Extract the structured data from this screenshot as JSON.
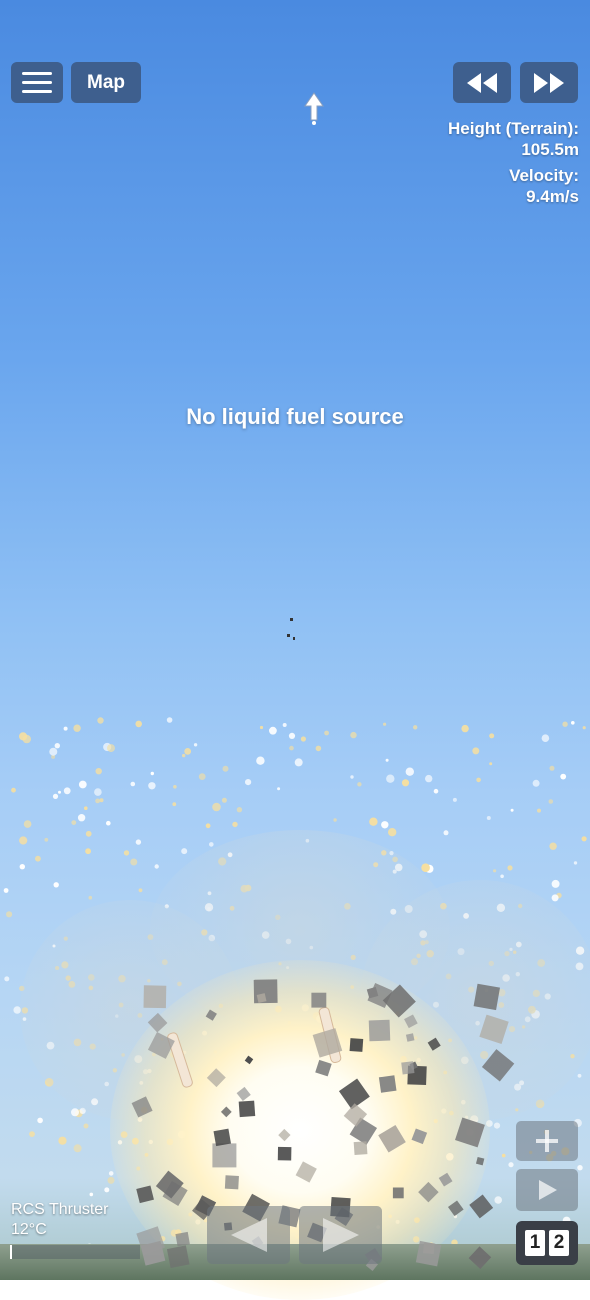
{
  "top_bar": {
    "menu_icon": "hamburger-menu-icon",
    "map_label": "Map",
    "rewind_icon": "rewind-icon",
    "fast_forward_icon": "fast-forward-icon"
  },
  "readouts": {
    "height_label": "Height (Terrain):",
    "height_value": "105.5m",
    "velocity_label": "Velocity:",
    "velocity_value": "9.4m/s"
  },
  "message": "No liquid fuel source",
  "bottom": {
    "part_name": "RCS Thruster",
    "temperature": "12°C",
    "stage_digits": [
      "1",
      "2"
    ],
    "zoom_in_icon": "plus-icon",
    "play_icon": "play-icon",
    "rotate_left_icon": "arrow-left-icon",
    "rotate_right_icon": "arrow-right-icon"
  },
  "colors": {
    "button_blue": "#3e5f8e",
    "sky_top": "#4a8ae0",
    "sky_bottom": "#c2dbee"
  }
}
